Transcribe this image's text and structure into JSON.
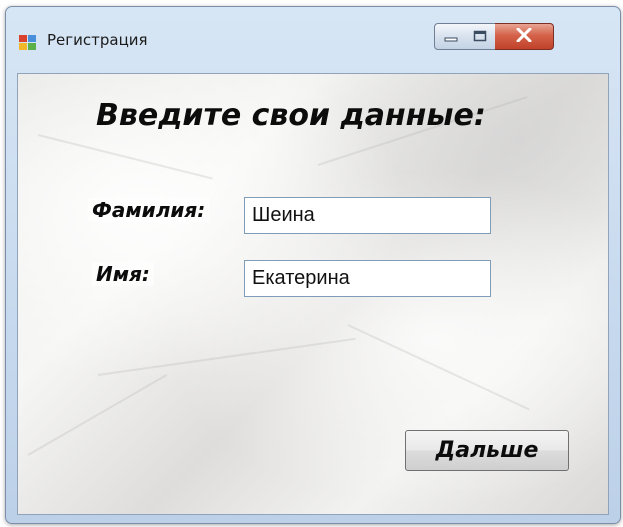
{
  "window": {
    "title": "Регистрация"
  },
  "form": {
    "heading": "Введите свои данные:",
    "surname_label": "Фамилия:",
    "surname_value": "Шеина",
    "name_label": "Имя:",
    "name_value": "Екатерина",
    "next_button": "Дальше"
  },
  "icons": {
    "app": "app-window-icon",
    "minimize": "minimize-icon",
    "maximize": "maximize-icon",
    "close": "close-icon"
  },
  "colors": {
    "close_button": "#c9472f",
    "title_bar": "#c7d9ee",
    "input_border": "#7f9db9"
  }
}
